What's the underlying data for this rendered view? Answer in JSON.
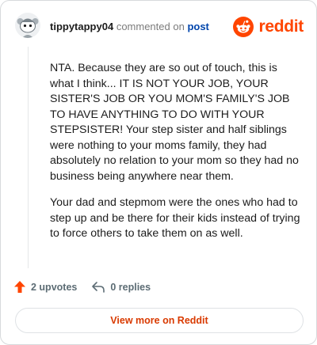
{
  "header": {
    "username": "tippytappy04",
    "action_text": "commented on",
    "post_link": "post",
    "brand": "reddit"
  },
  "comment": {
    "paragraphs": [
      "NTA. Because they are so out of touch, this is what I think... IT IS NOT YOUR JOB, YOUR SISTER'S JOB OR YOU MOM'S FAMILY'S JOB TO HAVE ANYTHING TO DO WITH YOUR STEPSISTER! Your step sister and half siblings were nothing to your moms family, they had absolutely no relation to your mom so they had no business being anywhere near them.",
      "Your dad and stepmom were the ones who had to step up and be there for their kids instead of trying to force others to take them on as well."
    ]
  },
  "actions": {
    "upvotes": "2 upvotes",
    "replies": "0 replies"
  },
  "footer": {
    "view_more": "View more on Reddit"
  },
  "colors": {
    "brand": "#ff4500",
    "link": "#0045ac",
    "view_more": "#d93a00"
  }
}
